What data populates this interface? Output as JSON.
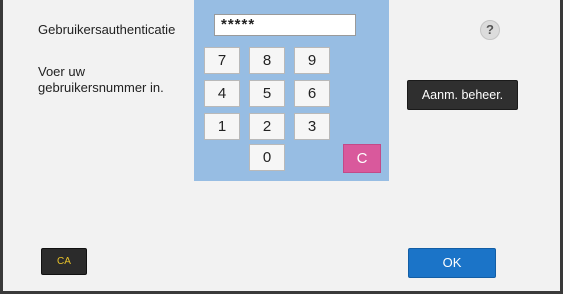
{
  "header": {
    "title": "Gebruikersauthenticatie",
    "help_label": "?"
  },
  "prompt": {
    "text": "Voer uw gebruikersnummer in."
  },
  "keypad": {
    "display_value": "*****",
    "keys": [
      "7",
      "8",
      "9",
      "4",
      "5",
      "6",
      "1",
      "2",
      "3",
      "0"
    ],
    "clear_label": "C"
  },
  "buttons": {
    "admin_label": "Aanm. beheer.",
    "ca_label": "CA",
    "ok_label": "OK"
  },
  "colors": {
    "keypad_background": "#97bde3",
    "clear_key": "#d9599c",
    "ok_button": "#1b74c8",
    "ca_text": "#e8c22a"
  }
}
